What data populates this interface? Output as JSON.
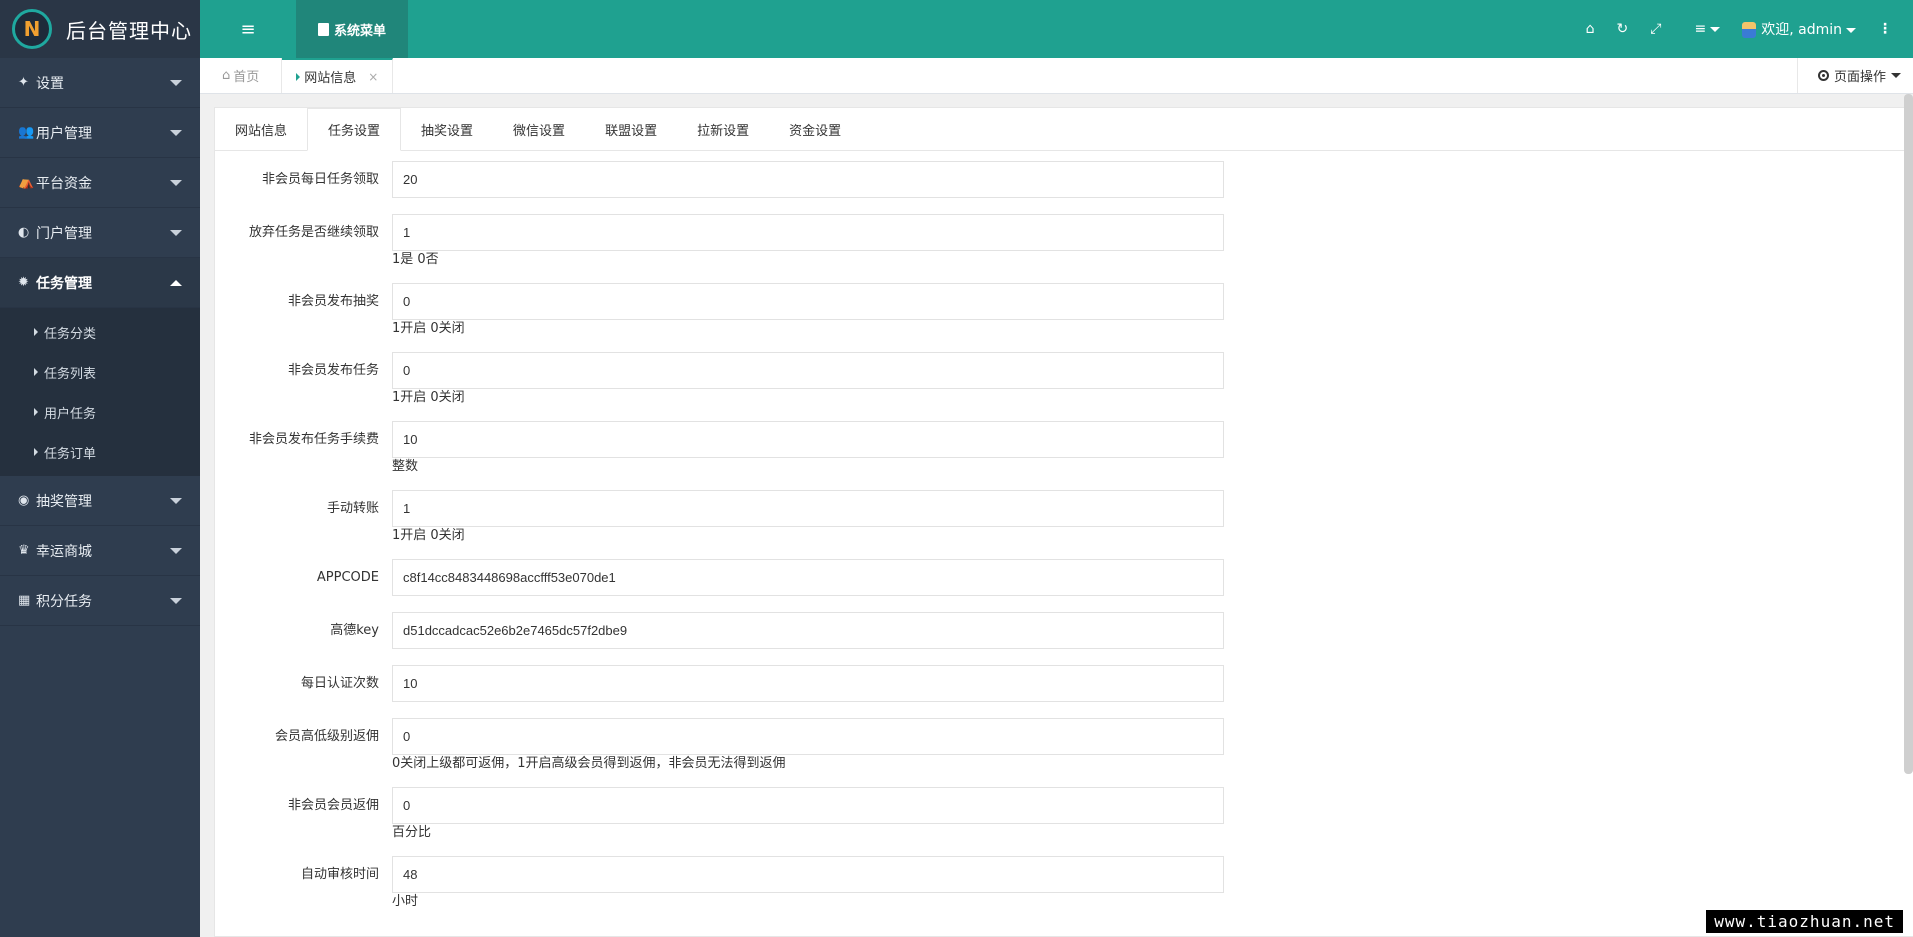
{
  "brand": {
    "logo_letter": "N",
    "title": "后台管理中心"
  },
  "sidebar": {
    "items": [
      {
        "label": "设置",
        "icon": "✦"
      },
      {
        "label": "用户管理",
        "icon": "👥"
      },
      {
        "label": "平台资金",
        "icon": "⛺"
      },
      {
        "label": "门户管理",
        "icon": "◐"
      },
      {
        "label": "任务管理",
        "icon": "✹"
      },
      {
        "label": "抽奖管理",
        "icon": "◉"
      },
      {
        "label": "幸运商城",
        "icon": "♛"
      },
      {
        "label": "积分任务",
        "icon": "▦"
      }
    ],
    "task_submenu": [
      "任务分类",
      "任务列表",
      "用户任务",
      "任务订单"
    ]
  },
  "topbar": {
    "menu_toggle_icon": "≡",
    "system_menu_label": "系统菜单",
    "home_icon": "⌂",
    "refresh_icon": "↻",
    "fullscreen_icon": "⤢",
    "list_icon": "≡",
    "welcome_text": "欢迎, admin",
    "more_icon": "⋮"
  },
  "page_tabs": {
    "home_label": "首页",
    "home_icon": "⌂",
    "active_label": "网站信息",
    "close_icon": "×",
    "ops_label": "页面操作"
  },
  "settings_tabs": [
    "网站信息",
    "任务设置",
    "抽奖设置",
    "微信设置",
    "联盟设置",
    "拉新设置",
    "资金设置"
  ],
  "form": [
    {
      "label": "非会员每日任务领取",
      "value": "20",
      "hint": ""
    },
    {
      "label": "放弃任务是否继续领取",
      "value": "1",
      "hint": "1是 0否"
    },
    {
      "label": "非会员发布抽奖",
      "value": "0",
      "hint": "1开启 0关闭"
    },
    {
      "label": "非会员发布任务",
      "value": "0",
      "hint": "1开启 0关闭"
    },
    {
      "label": "非会员发布任务手续费",
      "value": "10",
      "hint": "整数"
    },
    {
      "label": "手动转账",
      "value": "1",
      "hint": "1开启 0关闭"
    },
    {
      "label": "APPCODE",
      "value": "c8f14cc8483448698accfff53e070de1",
      "hint": ""
    },
    {
      "label": "高德key",
      "value": "d51dccadcac52e6b2e7465dc57f2dbe9",
      "hint": ""
    },
    {
      "label": "每日认证次数",
      "value": "10",
      "hint": ""
    },
    {
      "label": "会员高低级别返佣",
      "value": "0",
      "hint": "0关闭上级都可返佣，1开启高级会员得到返佣，非会员无法得到返佣"
    },
    {
      "label": "非会员会员返佣",
      "value": "0",
      "hint": "百分比"
    },
    {
      "label": "自动审核时间",
      "value": "48",
      "hint": "小时"
    }
  ],
  "watermark": "www.tiaozhuan.net",
  "colors": {
    "sidebar_bg": "#2f3d4f",
    "topbar_bg": "#1fa190",
    "accent": "#1fa190"
  }
}
